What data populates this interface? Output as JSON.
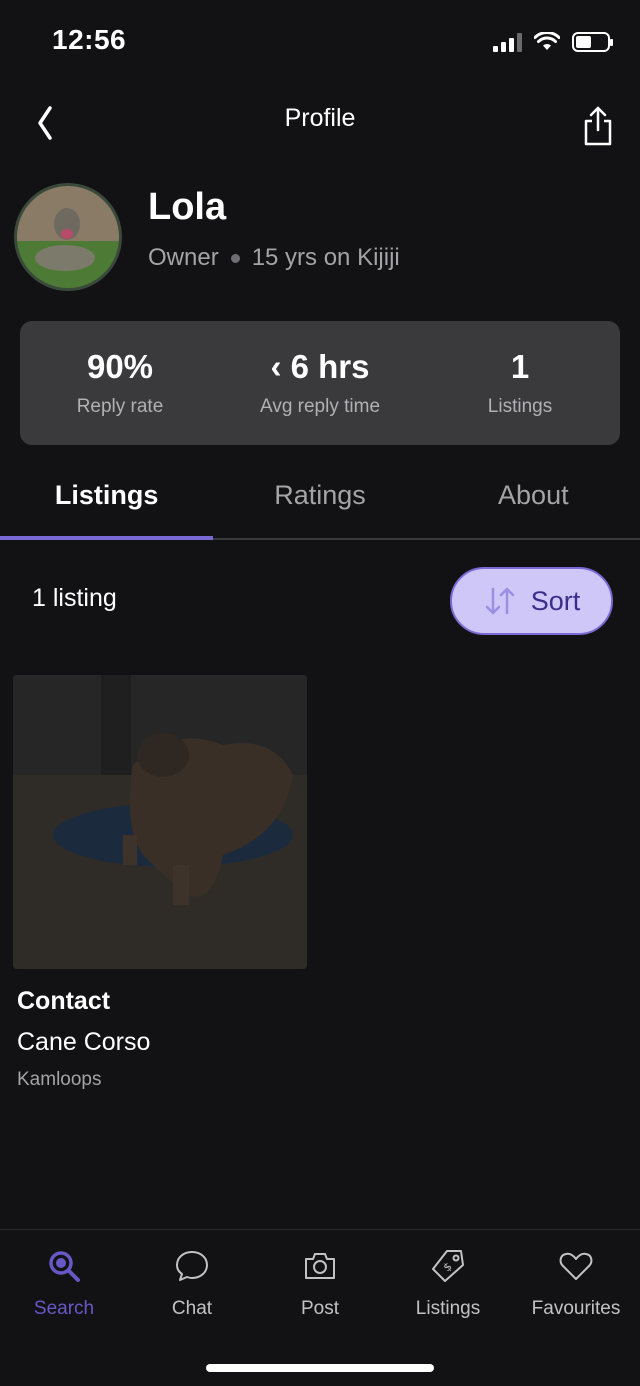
{
  "status_bar": {
    "time": "12:56"
  },
  "header": {
    "title": "Profile"
  },
  "profile": {
    "name": "Lola",
    "role": "Owner",
    "tenure": "15 yrs on Kijiji"
  },
  "stats": [
    {
      "value": "90%",
      "label": "Reply rate"
    },
    {
      "value": "‹ 6 hrs",
      "label": "Avg reply time"
    },
    {
      "value": "1",
      "label": "Listings"
    }
  ],
  "tabs": [
    {
      "label": "Listings",
      "active": true
    },
    {
      "label": "Ratings",
      "active": false
    },
    {
      "label": "About",
      "active": false
    }
  ],
  "listing_toolbar": {
    "count": "1 listing",
    "sort_label": "Sort"
  },
  "listings": [
    {
      "price": "Contact",
      "title": "Cane Corso",
      "location": "Kamloops"
    }
  ],
  "bottom_nav": [
    {
      "label": "Search",
      "icon": "search-icon",
      "active": true
    },
    {
      "label": "Chat",
      "icon": "chat-bubble-icon",
      "active": false
    },
    {
      "label": "Post",
      "icon": "camera-icon",
      "active": false
    },
    {
      "label": "Listings",
      "icon": "price-tag-icon",
      "active": false
    },
    {
      "label": "Favourites",
      "icon": "heart-icon",
      "active": false
    }
  ],
  "colors": {
    "background": "#121214",
    "card": "#3a3a3d",
    "accent": "#7a6ad4",
    "sort_bg": "#cfc7f7",
    "nav_active": "#6857c6"
  }
}
